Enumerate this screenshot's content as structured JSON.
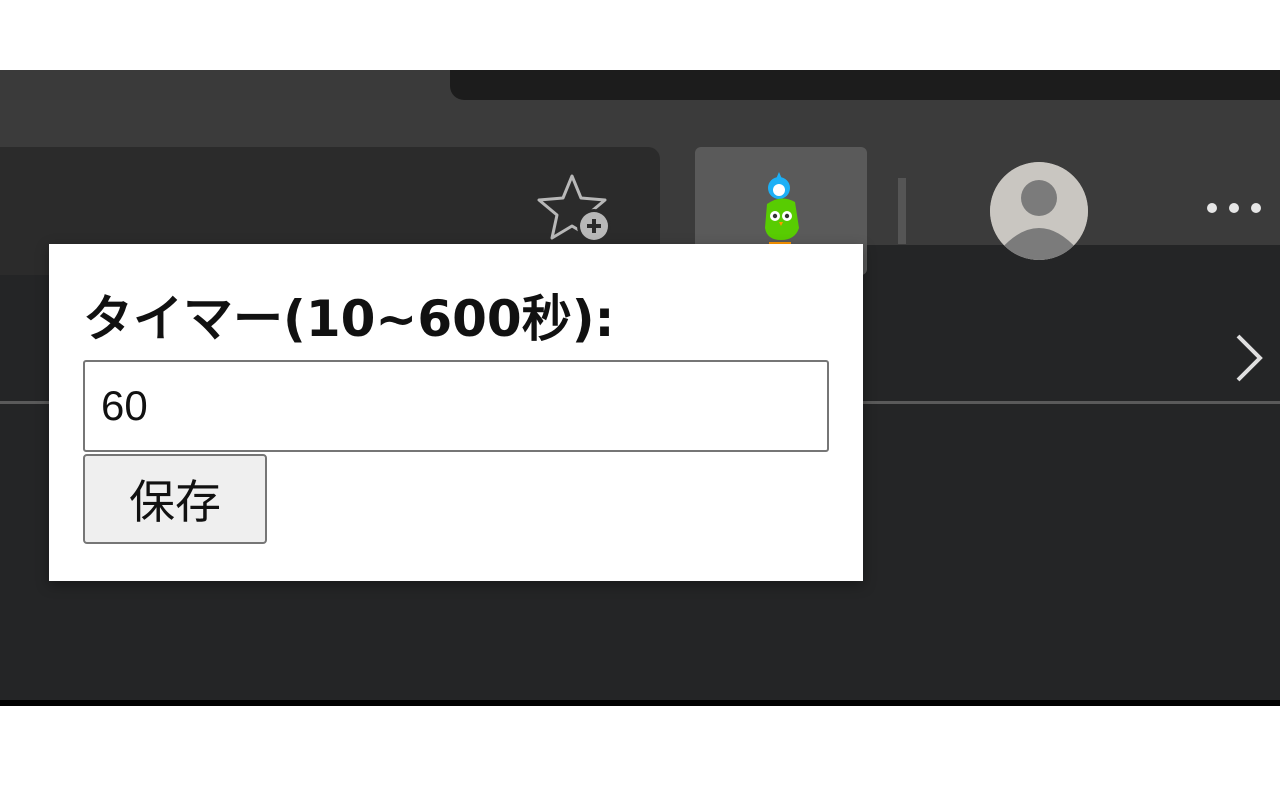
{
  "toolbar": {
    "favorites_icon": "star-add-icon",
    "extension_icon": "owl-extension-icon",
    "profile_icon": "avatar-icon",
    "menu_icon": "more-dots-icon",
    "menu_text": "⋯"
  },
  "popup": {
    "label": "タイマー(10~600秒):",
    "input_value": "60",
    "save_label": "保存"
  },
  "colors": {
    "browser_bg": "#242526",
    "toolbar_bg": "#3b3b3b",
    "addressbar_bg": "#2b2b2b",
    "extension_button_bg": "#5a5a5a",
    "popup_bg": "#ffffff",
    "owl_green": "#58cc02"
  }
}
